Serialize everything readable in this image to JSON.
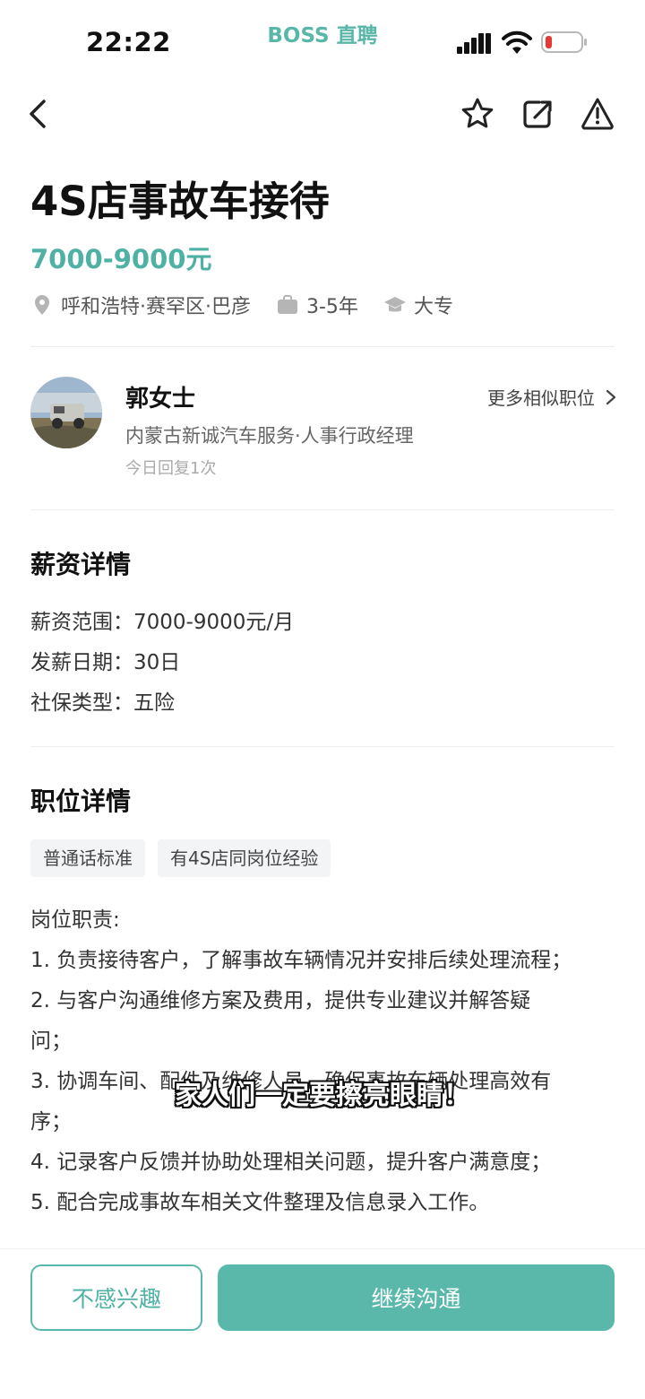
{
  "status_bar": {
    "time": "22:22",
    "watermark": "BOSS 直聘"
  },
  "nav": {
    "back_icon": "chevron-left-icon",
    "star_icon": "star-icon",
    "share_icon": "share-icon",
    "report_icon": "warning-icon"
  },
  "job": {
    "title": "4S店事故车接待",
    "salary": "7000-9000元",
    "location": "呼和浩特·赛罕区·巴彦",
    "experience": "3-5年",
    "education": "大专"
  },
  "recruiter": {
    "name": "郭女士",
    "company": "内蒙古新诚汽车服务·人事行政经理",
    "reply": "今日回复1次",
    "more_label": "更多相似职位"
  },
  "salary_section": {
    "title": "薪资详情",
    "range": "薪资范围：7000-9000元/月",
    "pay_day": "发薪日期：30日",
    "insurance": "社保类型：五险"
  },
  "position_section": {
    "title": "职位详情",
    "tags": [
      "普通话标准",
      "有4S店同岗位经验"
    ],
    "duties_heading": "岗位职责:",
    "duties": [
      "1. 负责接待客户，了解事故车辆情况并安排后续处理流程；",
      "2. 与客户沟通维修方案及费用，提供专业建议并解答疑",
      "问；",
      "3. 协调车间、配件及维修人员，确保事故车辆处理高效有",
      "序；",
      "4. 记录客户反馈并协助处理相关问题，提升客户满意度；",
      "5. 配合完成事故车相关文件整理及信息录入工作。"
    ]
  },
  "caption": "家人们一定要擦亮眼睛！",
  "actions": {
    "not_interested": "不感兴趣",
    "continue_chat": "继续沟通"
  },
  "colors": {
    "accent": "#5ab8ab",
    "salary": "#4fb1a4"
  }
}
